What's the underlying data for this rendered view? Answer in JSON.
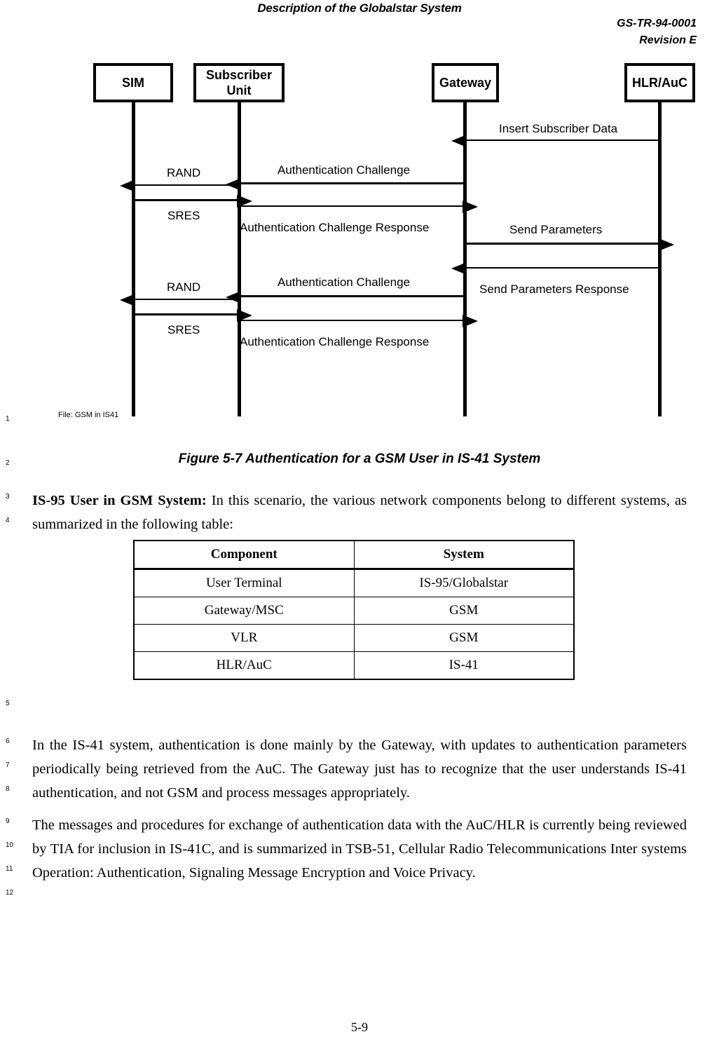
{
  "header": {
    "title": "Description of the Globalstar System",
    "doc_number": "GS-TR-94-0001",
    "revision": "Revision E"
  },
  "figure": {
    "nodes": [
      {
        "id": "sim",
        "label": "SIM"
      },
      {
        "id": "subscriber-unit",
        "label": "Subscriber\nUnit"
      },
      {
        "id": "gateway",
        "label": "Gateway"
      },
      {
        "id": "hlr-auc",
        "label": "HLR/AuC"
      }
    ],
    "messages": [
      {
        "id": "m1",
        "label": "Insert Subscriber Data",
        "from": "hlr-auc",
        "to": "gateway",
        "direction": "left"
      },
      {
        "id": "m2",
        "label": "Authentication Challenge",
        "from": "gateway",
        "to": "subscriber-unit",
        "direction": "left"
      },
      {
        "id": "m3",
        "label": "RAND",
        "from": "subscriber-unit",
        "to": "sim",
        "direction": "left"
      },
      {
        "id": "m4",
        "label": "SRES",
        "from": "sim",
        "to": "subscriber-unit",
        "direction": "right"
      },
      {
        "id": "m5",
        "label": "Authentication Challenge Response",
        "from": "subscriber-unit",
        "to": "gateway",
        "direction": "right"
      },
      {
        "id": "m6",
        "label": "Send Parameters",
        "from": "gateway",
        "to": "hlr-auc",
        "direction": "right"
      },
      {
        "id": "m7",
        "label": "Send Parameters Response",
        "from": "hlr-auc",
        "to": "gateway",
        "direction": "left"
      },
      {
        "id": "m8",
        "label": "Authentication Challenge",
        "from": "gateway",
        "to": "subscriber-unit",
        "direction": "left"
      },
      {
        "id": "m9",
        "label": "RAND",
        "from": "subscriber-unit",
        "to": "sim",
        "direction": "left"
      },
      {
        "id": "m10",
        "label": "SRES",
        "from": "sim",
        "to": "subscriber-unit",
        "direction": "right"
      },
      {
        "id": "m11",
        "label": "Authentication Challenge Response",
        "from": "subscriber-unit",
        "to": "gateway",
        "direction": "right"
      }
    ],
    "file_note": "File: GSM in IS41",
    "caption": "Figure 5-7 Authentication for a GSM User in IS-41 System"
  },
  "body": {
    "para_is95_lead": "IS-95 User in GSM System:",
    "para_is95_rest": "  In this scenario, the various network components belong to different systems, as summarized in the following table:",
    "para_is41": "In the IS-41 system, authentication is done mainly by the Gateway, with updates to authentication parameters periodically being retrieved from the AuC.  The Gateway just has to recognize that the user understands IS-41 authentication, and not GSM and process messages appropriately.",
    "para_tia": "The messages and procedures for exchange of authentication data with the AuC/HLR is currently being reviewed by TIA for inclusion in IS-41C, and is summarized in TSB-51, Cellular Radio Telecommunications Inter systems Operation: Authentication, Signaling Message Encryption and Voice Privacy."
  },
  "table": {
    "headers": [
      "Component",
      "System"
    ],
    "rows": [
      [
        "User Terminal",
        "IS-95/Globalstar"
      ],
      [
        "Gateway/MSC",
        "GSM"
      ],
      [
        "VLR",
        "GSM"
      ],
      [
        "HLR/AuC",
        "IS-41"
      ]
    ]
  },
  "line_numbers": [
    "1",
    "2",
    "3",
    "4",
    "5",
    "6",
    "7",
    "8",
    "9",
    "10",
    "11",
    "12"
  ],
  "footer": {
    "page": "5-9"
  }
}
